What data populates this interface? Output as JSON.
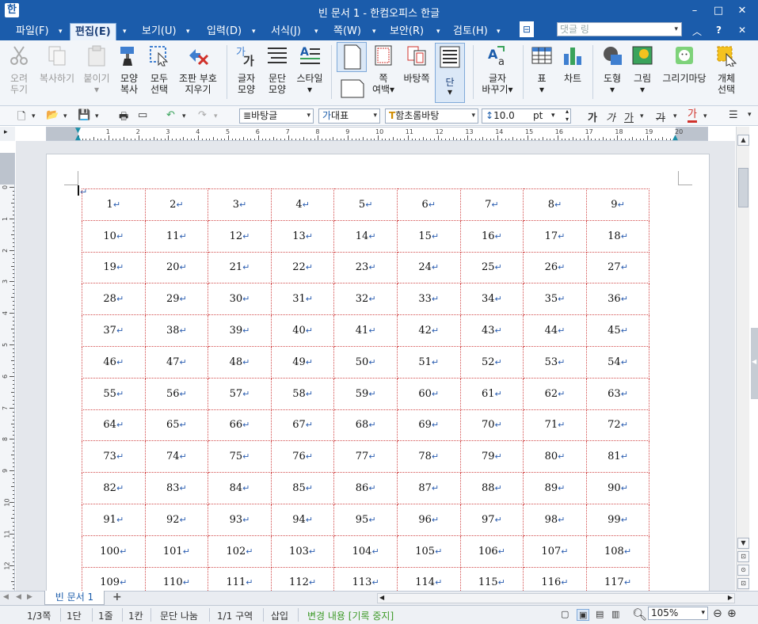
{
  "title": {
    "app_icon": "한",
    "text": "빈 문서 1 - 한컴오피스 한글"
  },
  "window_controls": {
    "minimize": "–",
    "maximize": "□",
    "close": "✕"
  },
  "menu": [
    {
      "label": "파일(F)",
      "dropdown": "▾"
    },
    {
      "label": "편집(E)",
      "dropdown": "▾"
    },
    {
      "label": "보기(U)",
      "dropdown": "▾"
    },
    {
      "label": "입력(D)",
      "dropdown": "▾"
    },
    {
      "label": "서식(J)",
      "dropdown": "▾"
    },
    {
      "label": "쪽(W)",
      "dropdown": "▾"
    },
    {
      "label": "보안(R)",
      "dropdown": "▾"
    },
    {
      "label": "검토(H)",
      "dropdown": "▾"
    }
  ],
  "menu_right": {
    "comment_placeholder": "댓글 링",
    "caret_up": "︿",
    "help": "?",
    "close": "✕",
    "overflow": "⊟"
  },
  "ribbon": [
    {
      "label1": "오려",
      "label2": "두기",
      "icon": "scissors-icon",
      "enabled": false
    },
    {
      "label1": "복사하기",
      "label2": "",
      "icon": "copy-icon",
      "enabled": false
    },
    {
      "label1": "붙이기",
      "label2": "▾",
      "icon": "paste-icon",
      "enabled": false
    },
    {
      "label1": "모양",
      "label2": "복사",
      "icon": "format-painter-icon",
      "enabled": true
    },
    {
      "label1": "모두",
      "label2": "선택",
      "icon": "select-all-icon",
      "enabled": true
    },
    {
      "label1": "조판 부호",
      "label2": "지우기",
      "icon": "clear-codes-icon",
      "enabled": true
    },
    {
      "label1": "글자",
      "label2": "모양",
      "icon": "char-shape-icon",
      "enabled": true
    },
    {
      "label1": "문단",
      "label2": "모양",
      "icon": "para-shape-icon",
      "enabled": true
    },
    {
      "label1": "스타일",
      "label2": "▾",
      "icon": "style-icon",
      "enabled": true
    },
    {
      "label1": "",
      "label2": "",
      "icon": "page-icon",
      "enabled": true
    },
    {
      "label1": "쪽",
      "label2": "여백▾",
      "icon": "page-margin-icon",
      "enabled": true
    },
    {
      "label1": "바탕쪽",
      "label2": "",
      "icon": "master-page-icon",
      "enabled": true
    },
    {
      "label1": "단",
      "label2": "▾",
      "icon": "columns-icon",
      "enabled": true
    },
    {
      "label1": "글자",
      "label2": "바꾸기▾",
      "icon": "replace-char-icon",
      "enabled": true
    },
    {
      "label1": "표",
      "label2": "▾",
      "icon": "table-icon",
      "enabled": true
    },
    {
      "label1": "차트",
      "label2": "",
      "icon": "chart-icon",
      "enabled": true
    },
    {
      "label1": "도형",
      "label2": "▾",
      "icon": "shape-icon",
      "enabled": true
    },
    {
      "label1": "그림",
      "label2": "▾",
      "icon": "picture-icon",
      "enabled": true
    },
    {
      "label1": "그리기마당",
      "label2": "",
      "icon": "drawing-gallery-icon",
      "enabled": true
    },
    {
      "label1": "개체",
      "label2": "선택",
      "icon": "object-select-icon",
      "enabled": true
    }
  ],
  "format_bar": {
    "style": "바탕글",
    "lang": "대표",
    "font": "함초롬바탕",
    "size": "10.0",
    "size_unit": "pt",
    "style_prefix": "≣",
    "lang_prefix": "가",
    "font_prefix": "T",
    "size_prefix": "↕",
    "bold": "가",
    "italic": "가",
    "underline": "가",
    "strike": "가",
    "color": "가"
  },
  "ruler": {
    "h_ticks": [
      "1",
      "2",
      "3",
      "4",
      "5",
      "6",
      "7",
      "8",
      "9",
      "10",
      "11",
      "12",
      "13",
      "14",
      "15",
      "16",
      "17",
      "18",
      "19",
      "20"
    ],
    "v_ticks": [
      "0",
      "1",
      "2",
      "3",
      "4",
      "5",
      "6",
      "7",
      "8",
      "9",
      "10",
      "11",
      "12"
    ]
  },
  "table": {
    "cells": [
      "1",
      "2",
      "3",
      "4",
      "5",
      "6",
      "7",
      "8",
      "9",
      "10",
      "11",
      "12",
      "13",
      "14",
      "15",
      "16",
      "17",
      "18",
      "19",
      "20",
      "21",
      "22",
      "23",
      "24",
      "25",
      "26",
      "27",
      "28",
      "29",
      "30",
      "31",
      "32",
      "33",
      "34",
      "35",
      "36",
      "37",
      "38",
      "39",
      "40",
      "41",
      "42",
      "43",
      "44",
      "45",
      "46",
      "47",
      "48",
      "49",
      "50",
      "51",
      "52",
      "53",
      "54",
      "55",
      "56",
      "57",
      "58",
      "59",
      "60",
      "61",
      "62",
      "63",
      "64",
      "65",
      "66",
      "67",
      "68",
      "69",
      "70",
      "71",
      "72",
      "73",
      "74",
      "75",
      "76",
      "77",
      "78",
      "79",
      "80",
      "81",
      "82",
      "83",
      "84",
      "85",
      "86",
      "87",
      "88",
      "89",
      "90",
      "91",
      "92",
      "93",
      "94",
      "95",
      "96",
      "97",
      "98",
      "99",
      "100",
      "101",
      "102",
      "103",
      "104",
      "105",
      "106",
      "107",
      "108",
      "109",
      "110",
      "111",
      "112",
      "113",
      "114",
      "115",
      "116",
      "117"
    ],
    "return_mark": "↵",
    "cursor_mark": "↵"
  },
  "tabs": {
    "doc_tab": "빈 문서 1",
    "add": "+"
  },
  "status": {
    "page": "1/3쪽",
    "column": "1단",
    "line": "1줄",
    "cell": "1칸",
    "break": "문단 나눔",
    "section": "1/1 구역",
    "mode": "삽입",
    "track": "변경 내용 [기록 중지]",
    "zoom": "105%",
    "zoom_out": "⊖",
    "zoom_in": "⊕"
  },
  "colors": {
    "title_bg": "#1b5cab",
    "accent": "#1b5cab",
    "grid_border": "#d24b4b",
    "track_text": "#3d9a28"
  }
}
